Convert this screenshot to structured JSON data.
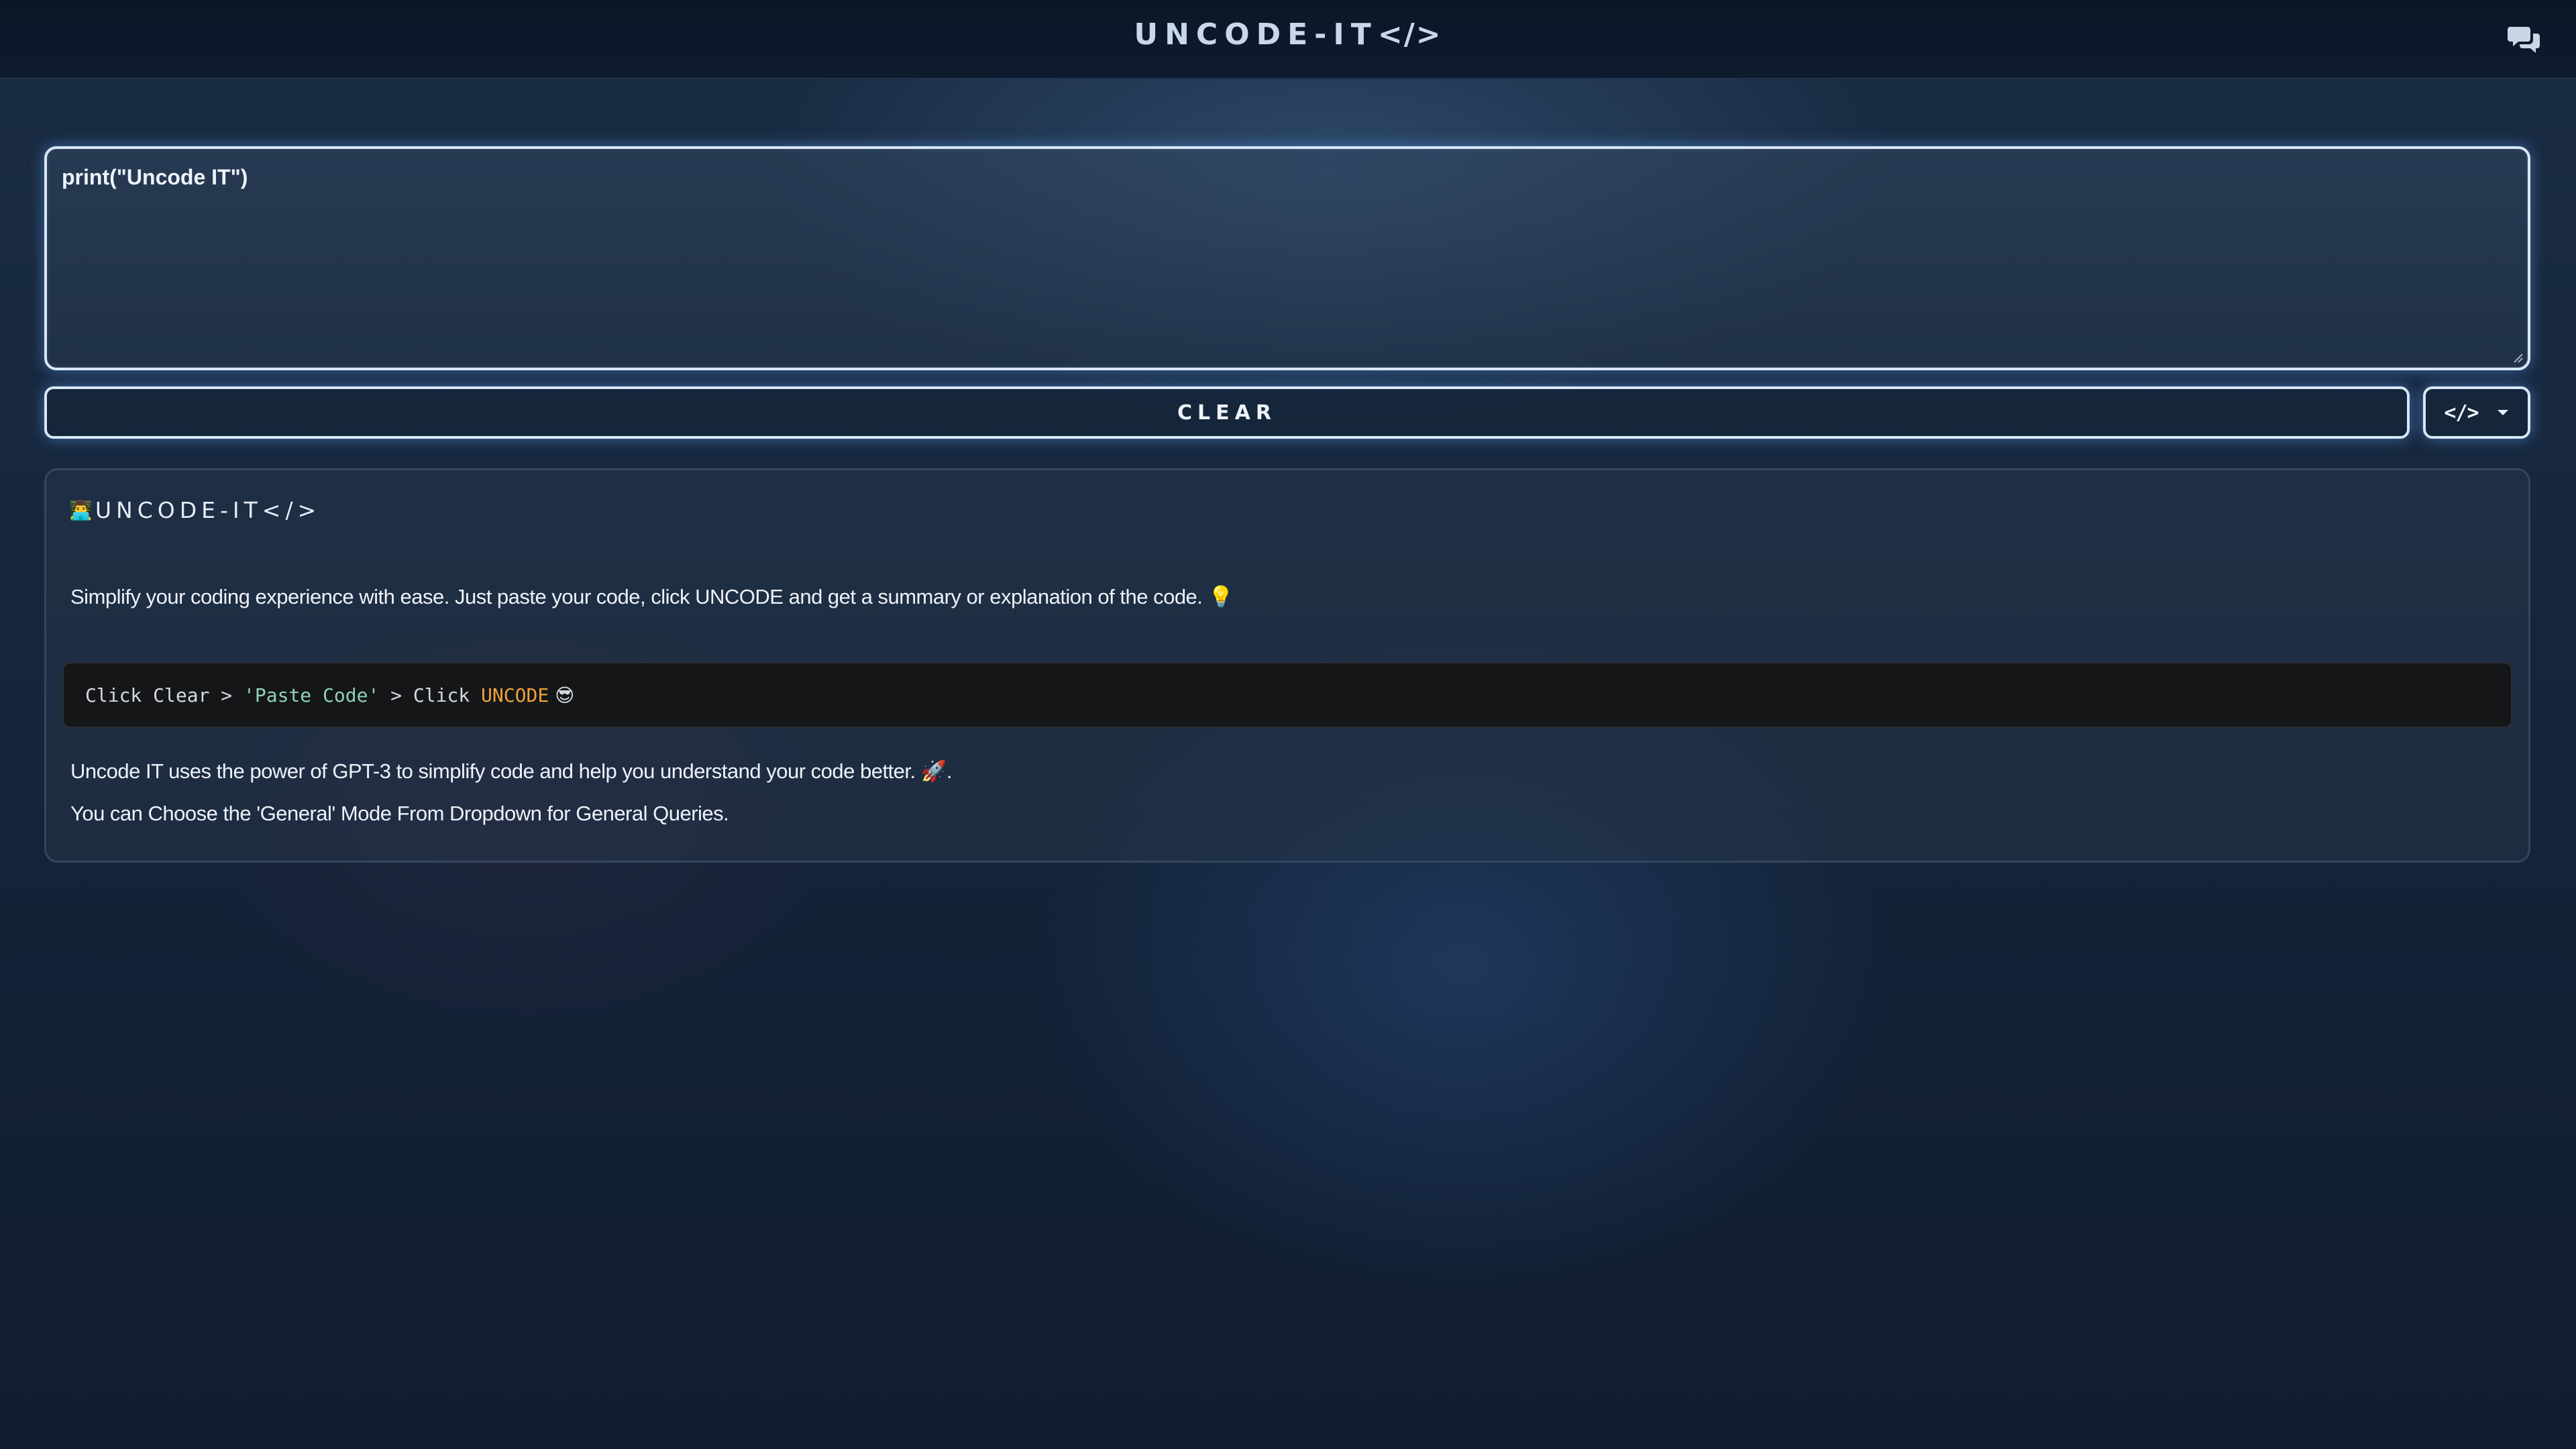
{
  "header": {
    "brand_text": "UNCODE-IT",
    "brand_tag": "</>",
    "chat_icon": "chat-bubbles-icon"
  },
  "editor": {
    "value": "print(\"Uncode IT\")"
  },
  "actions": {
    "clear_label": "CLEAR",
    "mode_selected": "</>",
    "mode_icon": "chevron-down-icon"
  },
  "info": {
    "title_emoji": "👨‍💻",
    "title_text": "UNCODE-IT</>",
    "description": "Simplify your coding experience with ease. Just paste your code, click UNCODE and get a summary or explanation of the code. 💡",
    "steps": {
      "part1": "Click Clear > ",
      "part2": "'Paste Code'",
      "part3": " > Click ",
      "part4": "UNCODE",
      "part5": " 😎"
    },
    "line_gpt": "Uncode IT uses the power of GPT-3 to simplify code and help you understand your code better. 🚀.",
    "line_mode": "You can Choose the 'General' Mode From Dropdown for General Queries."
  },
  "colors": {
    "accent_glow": "#5a96e6",
    "code_string": "#8fd3b6",
    "code_keyword": "#f0a23a"
  }
}
